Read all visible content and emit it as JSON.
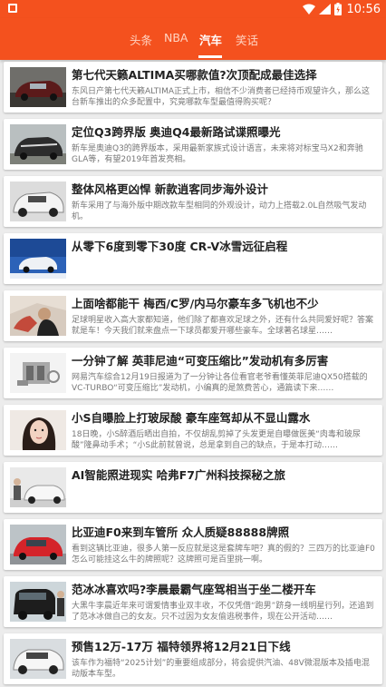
{
  "status_bar": {
    "time": "10:56"
  },
  "tabs": [
    {
      "label": "头条"
    },
    {
      "label": "NBA"
    },
    {
      "label": "汽车"
    },
    {
      "label": "笑话"
    }
  ],
  "articles": [
    {
      "title": "第七代天籁ALTIMA买哪款值?次顶配成最佳选择",
      "desc": "东风日产第七代天籁ALTIMA正式上市，相信不少消费者已经持币观望许久，那么这台新车推出的众多配置中，究竟哪款车型最值得购买呢？"
    },
    {
      "title": "定位Q3跨界版 奥迪Q4最新路试谍照曝光",
      "desc": "新车是奥迪Q3的跨界版本，采用最新家族式设计语言，未来将对标宝马X2和奔驰GLA等，有望2019年首发亮相。"
    },
    {
      "title": "整体风格更凶悍 新款逍客同步海外设计",
      "desc": "新车采用了与海外版中期改款车型相同的外观设计，动力上搭载2.0L自然吸气发动机。"
    },
    {
      "title": "从零下6度到零下30度 CR-V冰雪远征启程",
      "desc": ""
    },
    {
      "title": "上面啥都能干 梅西/C罗/内马尔豪车多飞机也不少",
      "desc": "足球明星收入高大家都知道，他们除了都喜欢足球之外，还有什么共同爱好呢？答案就是车！今天我们就来盘点一下球员都爱开哪些豪车。全球著名球星……"
    },
    {
      "title": "一分钟了解 英菲尼迪“可变压缩比”发动机有多厉害",
      "desc": "网易汽车综合12月19日报道为了一分钟让各位看官老爷看懂英菲尼迪QX50搭载的VC-TURBO“可变压缩比”发动机，小编真的是煞费苦心，通篇读下来……"
    },
    {
      "title": "小S自曝脸上打玻尿酸 豪车座驾却从不显山露水",
      "desc": "18日晚，小S醉酒后晒出自拍，不仅胡乱剪掉了头发更是自曝做医美“肉毒和玻尿酸”隆鼻动手术；“小S此前就曾说，总是拿到自己的缺点，于是本打动……"
    },
    {
      "title": "AI智能照进现实 哈弗F7广州科技探秘之旅",
      "desc": ""
    },
    {
      "title": "比亚迪F0来到车管所 众人质疑88888牌照",
      "desc": "看到这辆比亚迪，很多人第一反应就是这是套牌车吧？真的假的？三四万的比亚迪F0怎么可能挂这么牛的牌照呢？这牌照可是百里挑一啊。"
    },
    {
      "title": "范冰冰喜欢吗?李晨最霸气座驾相当于坐二楼开车",
      "desc": "大黑牛李晨近年来可谓爱情事业双丰收，不仅凭借“跑男”跻身一线明星行列，还追到了范冰冰做自己的女友。只不过因为女友偷逃税事件，现在公开活动……"
    },
    {
      "title": "预售12万-17万 福特领界将12月21日下线",
      "desc": "该车作为福特“2025计划”的重要组成部分，将会提供汽油、48V微混版本及插电混动版本车型。"
    }
  ],
  "colors": {
    "accent": "#f4511e",
    "tab_inactive": "#ffd4c2"
  },
  "icons": [
    "notification-square-icon",
    "wifi-icon",
    "signal-icon",
    "battery-icon"
  ]
}
